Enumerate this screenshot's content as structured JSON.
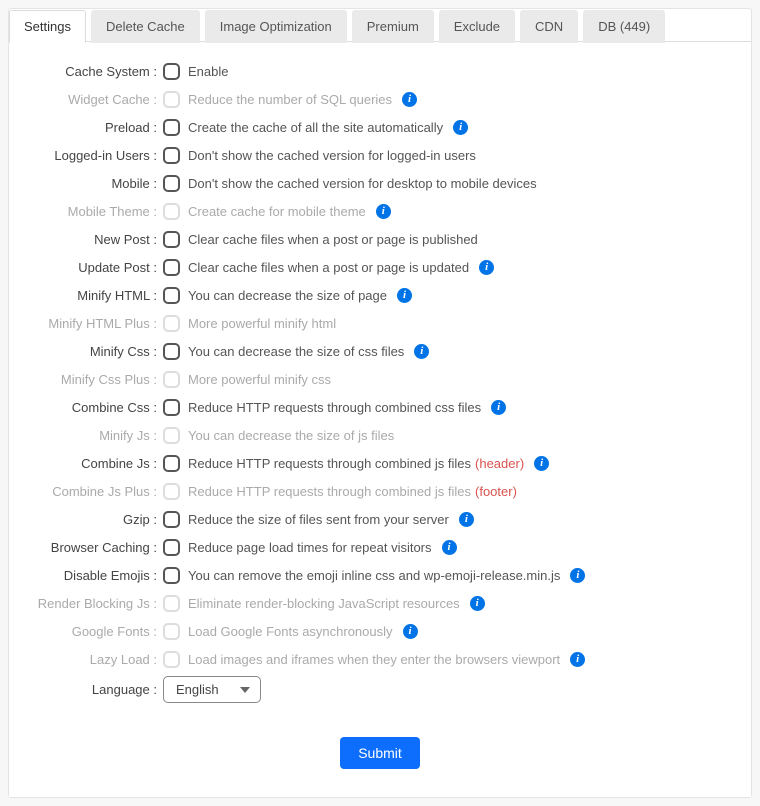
{
  "tabs": [
    "Settings",
    "Delete Cache",
    "Image Optimization",
    "Premium",
    "Exclude",
    "CDN",
    "DB (449)"
  ],
  "rows": [
    {
      "label": "Cache System :",
      "desc": "Enable",
      "info": false,
      "disabled": false,
      "extra": ""
    },
    {
      "label": "Widget Cache :",
      "desc": "Reduce the number of SQL queries",
      "info": true,
      "disabled": true,
      "extra": ""
    },
    {
      "label": "Preload :",
      "desc": "Create the cache of all the site automatically",
      "info": true,
      "disabled": false,
      "extra": ""
    },
    {
      "label": "Logged-in Users :",
      "desc": "Don't show the cached version for logged-in users",
      "info": false,
      "disabled": false,
      "extra": ""
    },
    {
      "label": "Mobile :",
      "desc": "Don't show the cached version for desktop to mobile devices",
      "info": false,
      "disabled": false,
      "extra": ""
    },
    {
      "label": "Mobile Theme :",
      "desc": "Create cache for mobile theme",
      "info": true,
      "disabled": true,
      "extra": ""
    },
    {
      "label": "New Post :",
      "desc": "Clear cache files when a post or page is published",
      "info": false,
      "disabled": false,
      "extra": ""
    },
    {
      "label": "Update Post :",
      "desc": "Clear cache files when a post or page is updated",
      "info": true,
      "disabled": false,
      "extra": ""
    },
    {
      "label": "Minify HTML :",
      "desc": "You can decrease the size of page",
      "info": true,
      "disabled": false,
      "extra": ""
    },
    {
      "label": "Minify HTML Plus :",
      "desc": "More powerful minify html",
      "info": false,
      "disabled": true,
      "extra": ""
    },
    {
      "label": "Minify Css :",
      "desc": "You can decrease the size of css files",
      "info": true,
      "disabled": false,
      "extra": ""
    },
    {
      "label": "Minify Css Plus :",
      "desc": "More powerful minify css",
      "info": false,
      "disabled": true,
      "extra": ""
    },
    {
      "label": "Combine Css :",
      "desc": "Reduce HTTP requests through combined css files",
      "info": true,
      "disabled": false,
      "extra": ""
    },
    {
      "label": "Minify Js :",
      "desc": "You can decrease the size of js files",
      "info": false,
      "disabled": true,
      "extra": ""
    },
    {
      "label": "Combine Js :",
      "desc": "Reduce HTTP requests through combined js files",
      "info": true,
      "disabled": false,
      "extra": "(header)"
    },
    {
      "label": "Combine Js Plus :",
      "desc": "Reduce HTTP requests through combined js files",
      "info": false,
      "disabled": true,
      "extra": "(footer)"
    },
    {
      "label": "Gzip :",
      "desc": "Reduce the size of files sent from your server",
      "info": true,
      "disabled": false,
      "extra": ""
    },
    {
      "label": "Browser Caching :",
      "desc": "Reduce page load times for repeat visitors",
      "info": true,
      "disabled": false,
      "extra": ""
    },
    {
      "label": "Disable Emojis :",
      "desc": "You can remove the emoji inline css and wp-emoji-release.min.js",
      "info": true,
      "disabled": false,
      "extra": ""
    },
    {
      "label": "Render Blocking Js :",
      "desc": "Eliminate render-blocking JavaScript resources",
      "info": true,
      "disabled": true,
      "extra": ""
    },
    {
      "label": "Google Fonts :",
      "desc": "Load Google Fonts asynchronously",
      "info": true,
      "disabled": true,
      "extra": ""
    },
    {
      "label": "Lazy Load :",
      "desc": "Load images and iframes when they enter the browsers viewport",
      "info": true,
      "disabled": true,
      "extra": ""
    }
  ],
  "languageRow": {
    "label": "Language :",
    "value": "English"
  },
  "submit": "Submit"
}
